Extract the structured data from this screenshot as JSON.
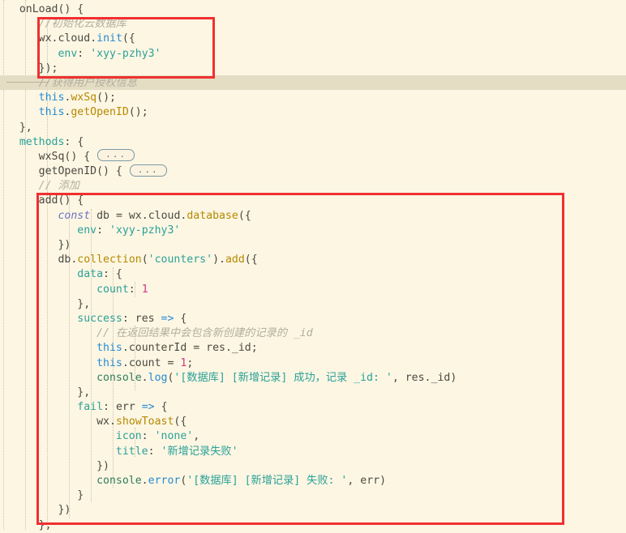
{
  "app": {
    "type": "code-editor",
    "language": "JavaScript",
    "theme": "solarized-light"
  },
  "colors": {
    "background": "#FDF6E3",
    "current_line_highlight": "#E4DDC4",
    "annotation_box": "#F03030",
    "indent_guide": "#C9C2AC",
    "comment": "#B2AE9E",
    "string": "#2AA198",
    "keyword": "#6C71C4",
    "this_keyword": "#268BD2",
    "function_name": "#B58900",
    "number": "#D33682",
    "default_text": "#4A4A42"
  },
  "folded_widget_label": "...",
  "annotations": [
    {
      "id": "box-cloud-init",
      "label": "red-highlight-box-cloud-init"
    },
    {
      "id": "box-add-method",
      "label": "red-highlight-box-add-method"
    }
  ],
  "code": {
    "lines": [
      {
        "n": 1,
        "indent": 1,
        "text": "onLoad() {"
      },
      {
        "n": 2,
        "indent": 2,
        "text": "//初始化云数据库"
      },
      {
        "n": 3,
        "indent": 2,
        "text": "wx.cloud.init({"
      },
      {
        "n": 4,
        "indent": 3,
        "text": "env: 'xyy-pzhy3'"
      },
      {
        "n": 5,
        "indent": 2,
        "text": "});"
      },
      {
        "n": 6,
        "indent": 2,
        "text": "//获得用户授权信息",
        "highlighted": true
      },
      {
        "n": 7,
        "indent": 2,
        "text": "this.wxSq();"
      },
      {
        "n": 8,
        "indent": 2,
        "text": "this.getOpenID();"
      },
      {
        "n": 9,
        "indent": 1,
        "text": "},"
      },
      {
        "n": 10,
        "indent": 1,
        "text": "methods: {"
      },
      {
        "n": 11,
        "indent": 2,
        "text": "wxSq() { ...",
        "folded": true
      },
      {
        "n": 12,
        "indent": 2,
        "text": "getOpenID() { ...",
        "folded": true
      },
      {
        "n": 13,
        "indent": 2,
        "text": "// 添加"
      },
      {
        "n": 14,
        "indent": 2,
        "text": "add() {"
      },
      {
        "n": 15,
        "indent": 3,
        "text": "const db = wx.cloud.database({"
      },
      {
        "n": 16,
        "indent": 4,
        "text": "env: 'xyy-pzhy3'"
      },
      {
        "n": 17,
        "indent": 3,
        "text": "})"
      },
      {
        "n": 18,
        "indent": 3,
        "text": "db.collection('counters').add({"
      },
      {
        "n": 19,
        "indent": 4,
        "text": "data: {"
      },
      {
        "n": 20,
        "indent": 5,
        "text": "count: 1"
      },
      {
        "n": 21,
        "indent": 4,
        "text": "},"
      },
      {
        "n": 22,
        "indent": 4,
        "text": "success: res => {"
      },
      {
        "n": 23,
        "indent": 5,
        "text": "// 在返回结果中会包含新创建的记录的 _id"
      },
      {
        "n": 24,
        "indent": 5,
        "text": "this.counterId = res._id;"
      },
      {
        "n": 25,
        "indent": 5,
        "text": "this.count = 1;"
      },
      {
        "n": 26,
        "indent": 5,
        "text": "console.log('[数据库] [新增记录] 成功，记录 _id: ', res._id)"
      },
      {
        "n": 27,
        "indent": 4,
        "text": "},"
      },
      {
        "n": 28,
        "indent": 4,
        "text": "fail: err => {"
      },
      {
        "n": 29,
        "indent": 5,
        "text": "wx.showToast({"
      },
      {
        "n": 30,
        "indent": 6,
        "text": "icon: 'none',"
      },
      {
        "n": 31,
        "indent": 6,
        "text": "title: '新增记录失败'"
      },
      {
        "n": 32,
        "indent": 5,
        "text": "})"
      },
      {
        "n": 33,
        "indent": 5,
        "text": "console.error('[数据库] [新增记录] 失败: ', err)"
      },
      {
        "n": 34,
        "indent": 4,
        "text": "}"
      },
      {
        "n": 35,
        "indent": 3,
        "text": "})"
      },
      {
        "n": 36,
        "indent": 2,
        "text": "},"
      }
    ]
  }
}
